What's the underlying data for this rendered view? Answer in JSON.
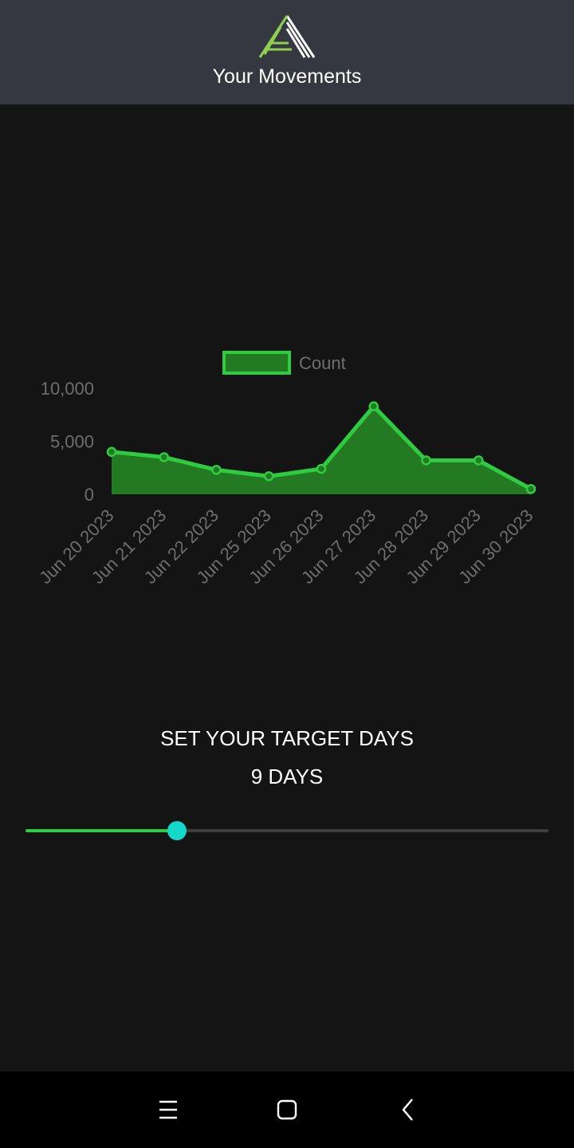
{
  "header": {
    "title": "Your Movements",
    "logo_icon": "mountain-logo-icon"
  },
  "colors": {
    "header_bg": "#353840",
    "page_bg": "#141414",
    "series_line": "#2ecc40",
    "series_fill": "#237a22",
    "slider_active": "#2ecc40",
    "slider_thumb": "#14d9c8",
    "axis_text": "#6e6e6e"
  },
  "chart_data": {
    "type": "area",
    "title": "",
    "xlabel": "",
    "ylabel": "",
    "x": [
      "Jun 20 2023",
      "Jun 21 2023",
      "Jun 22 2023",
      "Jun 25 2023",
      "Jun 26 2023",
      "Jun 27 2023",
      "Jun 28 2023",
      "Jun 29 2023",
      "Jun 30 2023"
    ],
    "series": [
      {
        "name": "Count",
        "values": [
          4000,
          3500,
          2300,
          1700,
          2400,
          8300,
          3200,
          3200,
          500
        ]
      }
    ],
    "ylim": [
      0,
      10000
    ],
    "yticks": [
      "10,000",
      "5,000",
      "0"
    ],
    "ytick_values": [
      10000,
      5000,
      0
    ],
    "legend": "top-center",
    "grid": false
  },
  "target": {
    "label": "SET YOUR TARGET DAYS",
    "value_text": "9 DAYS",
    "slider_fraction": 0.29
  },
  "navbar": {
    "menu_icon": "menu-icon",
    "home_icon": "home-square-icon",
    "back_icon": "back-chevron-icon"
  }
}
